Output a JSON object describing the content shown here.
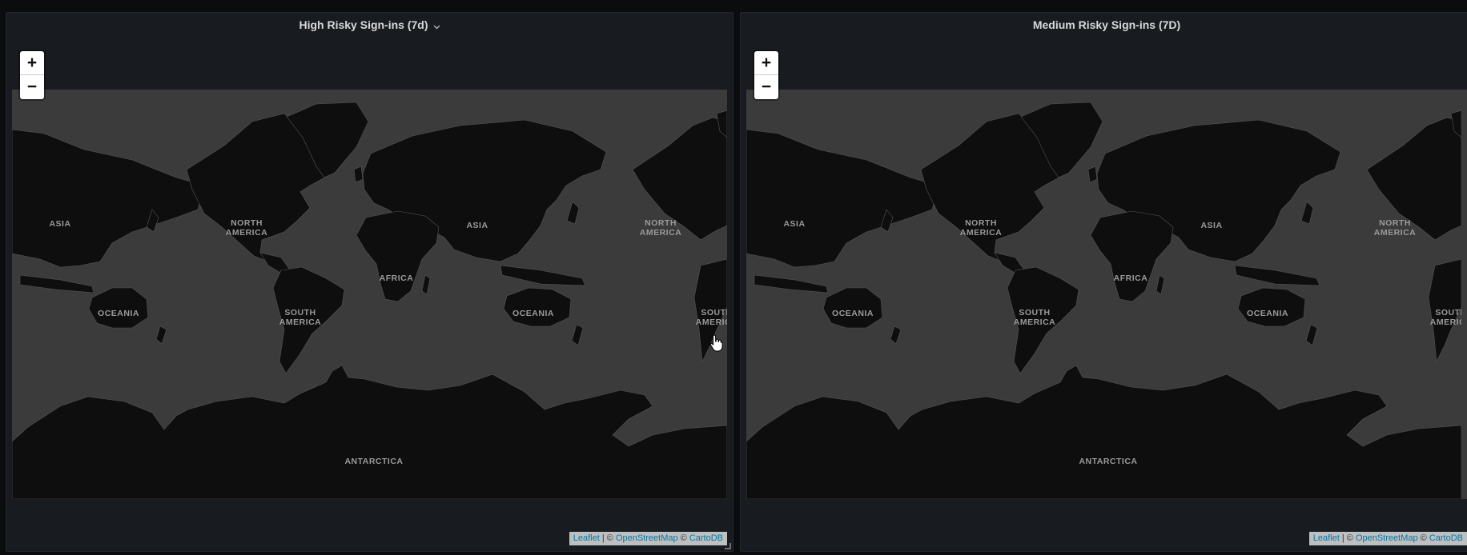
{
  "colors": {
    "page_bg": "#0b0c0e",
    "panel_bg": "#181b1f",
    "ocean": "#3b3b3b",
    "land": "#0e0e0e",
    "label": "#9a9a9a",
    "attribution_link": "#0078a8"
  },
  "panels": [
    {
      "title": "High Risky Sign-ins (7d)",
      "has_menu_chevron": true,
      "map": {
        "zoom_in_label": "+",
        "zoom_out_label": "−",
        "continent_labels": {
          "asia_west": "ASIA",
          "north_america_line1": "NORTH",
          "north_america_line2": "AMERICA",
          "asia": "ASIA",
          "north_america_east_line1": "NORTH",
          "north_america_east_line2": "AMERICA",
          "africa": "AFRICA",
          "oceania_west": "OCEANIA",
          "south_america_line1": "SOUTH",
          "south_america_line2": "AMERICA",
          "oceania": "OCEANIA",
          "south_america_east_line1": "SOUTH",
          "south_america_east_line2": "AMERICA",
          "antarctica": "ANTARCTICA"
        },
        "attribution": {
          "leaflet": "Leaflet",
          "separator": " | © ",
          "osm": "OpenStreetMap",
          "copy": " © ",
          "carto": "CartoDB"
        }
      }
    },
    {
      "title": "Medium Risky Sign-ins (7D)",
      "has_menu_chevron": false,
      "map": {
        "zoom_in_label": "+",
        "zoom_out_label": "−",
        "continent_labels": {
          "asia_west": "ASIA",
          "north_america_line1": "NORTH",
          "north_america_line2": "AMERICA",
          "asia": "ASIA",
          "north_america_east_line1": "NORTH",
          "north_america_east_line2": "AMERICA",
          "africa": "AFRICA",
          "oceania_west": "OCEANIA",
          "south_america_line1": "SOUTH",
          "south_america_line2": "AMERICA",
          "oceania": "OCEANIA",
          "south_america_east_line1": "SOUTH",
          "south_america_east_line2": "AMERICA",
          "antarctica": "ANTARCTICA"
        },
        "attribution": {
          "leaflet": "Leaflet",
          "separator": " | © ",
          "osm": "OpenStreetMap",
          "copy": " © ",
          "carto": "CartoDB"
        }
      }
    }
  ],
  "cursor_icon": "hand-pointer-icon"
}
